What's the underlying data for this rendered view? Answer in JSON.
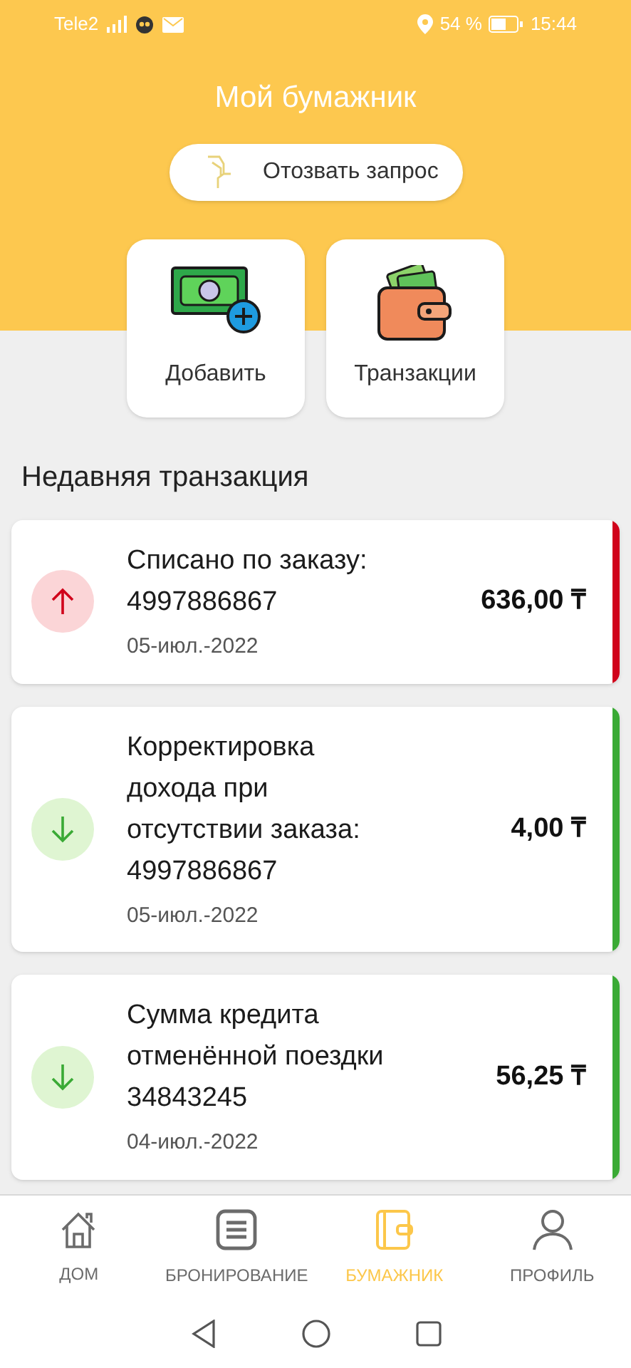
{
  "status_bar": {
    "carrier": "Tele2",
    "battery": "54 %",
    "time": "15:44"
  },
  "header": {
    "title": "Мой бумажник",
    "withdraw_button": "Отозвать запрос"
  },
  "actions": [
    {
      "kind": "add",
      "label": "Добавить"
    },
    {
      "kind": "transactions",
      "label": "Транзакции"
    }
  ],
  "section_title": "Недавняя транзакция",
  "transactions": [
    {
      "kind": "debit",
      "title": "Списано по заказу:\n4997886867",
      "date": "05-июл.-2022",
      "amount": "636,00 ₸",
      "color": "#d0021b"
    },
    {
      "kind": "credit",
      "title": "Корректировка\nдохода при\nотсутствии заказа:\n4997886867",
      "date": "05-июл.-2022",
      "amount": "4,00 ₸",
      "color": "#3aaa35"
    },
    {
      "kind": "credit",
      "title": "Сумма кредита\nотменённой поездки\n34843245",
      "date": "04-июл.-2022",
      "amount": "56,25 ₸",
      "color": "#3aaa35"
    }
  ],
  "bottom_nav": [
    {
      "kind": "home",
      "label": "ДОМ",
      "selected": false
    },
    {
      "kind": "booking",
      "label": "БРОНИРОВАНИЕ",
      "selected": false
    },
    {
      "kind": "wallet",
      "label": "БУМАЖНИК",
      "selected": true
    },
    {
      "kind": "profile",
      "label": "ПРОФИЛЬ",
      "selected": false
    }
  ]
}
